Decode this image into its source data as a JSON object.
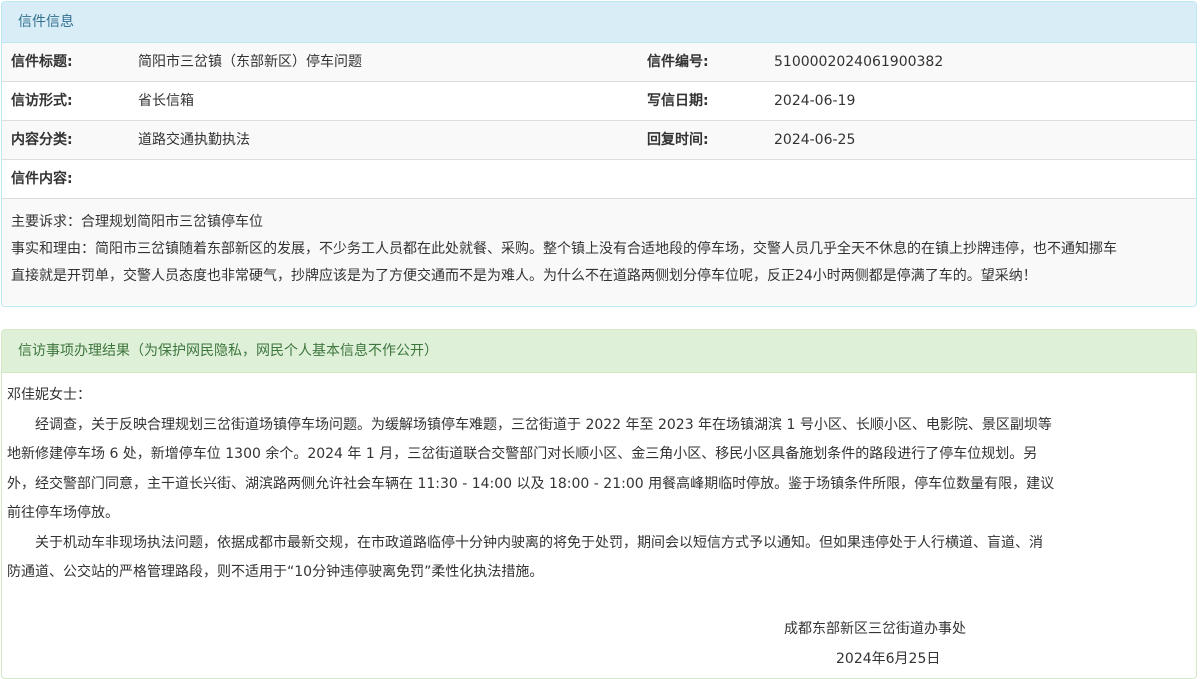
{
  "letter_panel": {
    "heading": "信件信息",
    "rows": [
      {
        "label1": "信件标题:",
        "value1": "简阳市三岔镇（东部新区）停车问题",
        "label2": "信件编号:",
        "value2": "5100002024061900382"
      },
      {
        "label1": "信访形式:",
        "value1": "省长信箱",
        "label2": "写信日期:",
        "value2": "2024-06-19"
      },
      {
        "label1": "内容分类:",
        "value1": "道路交通执勤执法",
        "label2": "回复时间:",
        "value2": "2024-06-25"
      }
    ],
    "content_label": "信件内容:",
    "content_lines": [
      "主要诉求：合理规划简阳市三岔镇停车位",
      "事实和理由：简阳市三岔镇随着东部新区的发展，不少务工人员都在此处就餐、采购。整个镇上没有合适地段的停车场，交警人员几乎全天不休息的在镇上抄牌违停，也不通知挪车",
      "直接就是开罚单，交警人员态度也非常硬气，抄牌应该是为了方便交通而不是为难人。为什么不在道路两侧划分停车位呢，反正24小时两侧都是停满了车的。望采纳！"
    ]
  },
  "result_panel": {
    "heading": "信访事项办理结果（为保护网民隐私，网民个人基本信息不作公开）",
    "salutation": "邓佳妮女士：",
    "paragraph1_lines": [
      "经调查，关于反映合理规划三岔街道场镇停车场问题。为缓解场镇停车难题，三岔街道于 2022 年至 2023 年在场镇湖滨 1 号小区、长顺小区、电影院、景区副坝等",
      "地新修建停车场 6 处，新增停车位 1300 余个。2024 年 1 月，三岔街道联合交警部门对长顺小区、金三角小区、移民小区具备施划条件的路段进行了停车位规划。另",
      "外，经交警部门同意，主干道长兴街、湖滨路两侧允许社会车辆在 11:30 - 14:00 以及 18:00 - 21:00 用餐高峰期临时停放。鉴于场镇条件所限，停车位数量有限，建议",
      "前往停车场停放。"
    ],
    "paragraph2_lines": [
      "关于机动车非现场执法问题，依据成都市最新交规，在市政道路临停十分钟内驶离的将免于处罚，期间会以短信方式予以通知。但如果违停处于人行横道、盲道、消",
      "防通道、公交站的严格管理路段，则不适用于“10分钟违停驶离免罚”柔性化执法措施。"
    ],
    "signature": "成都东部新区三岔街道办事处",
    "date": "2024年6月25日"
  }
}
